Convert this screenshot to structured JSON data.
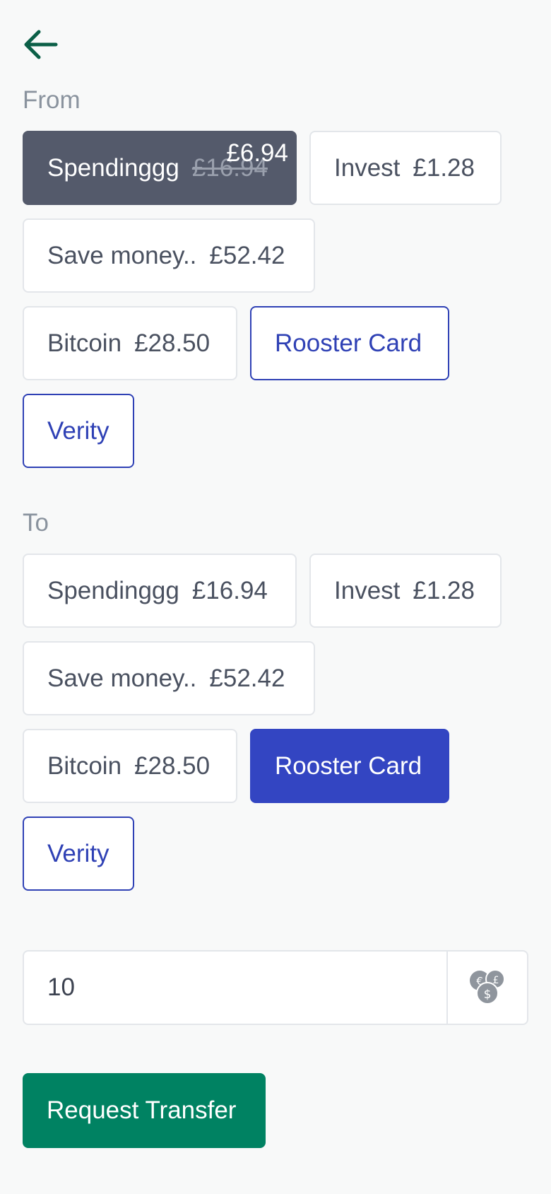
{
  "header": {
    "back_icon": "arrow-left-icon"
  },
  "from": {
    "label": "From",
    "selected": {
      "name": "Spendinggg",
      "old_amount": "£16.94",
      "new_amount": "£6.94"
    },
    "accounts": [
      {
        "name": "Invest",
        "amount": "£1.28"
      },
      {
        "name": "Save money..",
        "amount": "£52.42"
      },
      {
        "name": "Bitcoin",
        "amount": "£28.50"
      },
      {
        "name": "Rooster Card"
      },
      {
        "name": "Verity"
      }
    ]
  },
  "to": {
    "label": "To",
    "accounts": [
      {
        "name": "Spendinggg",
        "amount": "£16.94"
      },
      {
        "name": "Invest",
        "amount": "£1.28"
      },
      {
        "name": "Save money..",
        "amount": "£52.42"
      },
      {
        "name": "Bitcoin",
        "amount": "£28.50"
      },
      {
        "name": "Rooster Card",
        "selected": true
      },
      {
        "name": "Verity"
      }
    ]
  },
  "amount": {
    "value": "10",
    "currency_icon": "currency-exchange-icon"
  },
  "submit": {
    "label": "Request Transfer"
  },
  "colors": {
    "primary": "#3345c2",
    "selected_from": "#545a6b",
    "submit": "#008262",
    "back_arrow": "#0b5f47"
  }
}
